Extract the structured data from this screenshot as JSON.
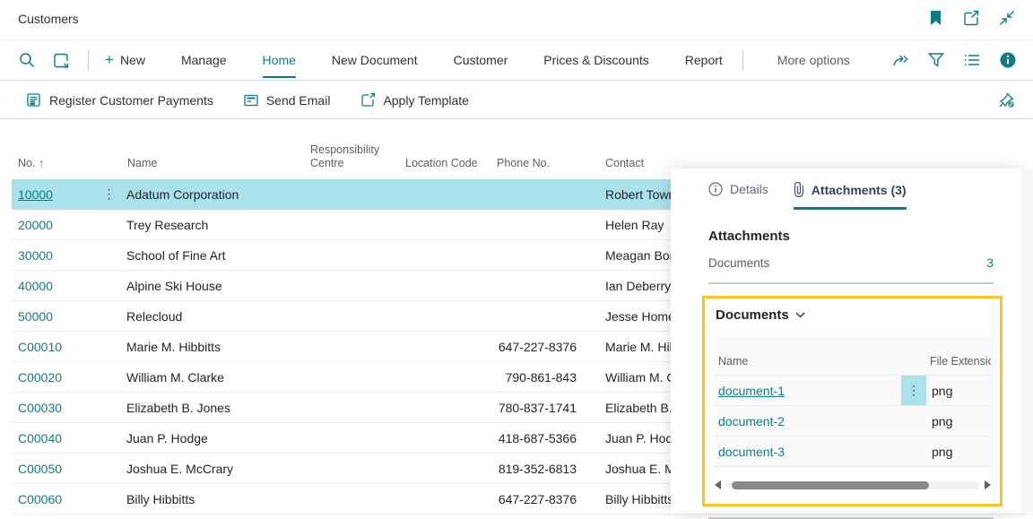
{
  "titlebar": {
    "title": "Customers",
    "icons": [
      "bookmark-icon",
      "open-in-new-icon",
      "collapse-icon"
    ]
  },
  "actionbar": {
    "left_icons": [
      "search-icon",
      "analyze-icon"
    ],
    "menu": [
      {
        "label": "New",
        "plus": true
      },
      {
        "label": "Manage"
      },
      {
        "label": "Home",
        "active": true
      },
      {
        "label": "New Document"
      },
      {
        "label": "Customer"
      },
      {
        "label": "Prices & Discounts"
      },
      {
        "label": "Report"
      }
    ],
    "more_options": "More options",
    "right_icons": [
      "share-icon",
      "filter-icon",
      "list-icon",
      "info-icon"
    ]
  },
  "quickbar": {
    "actions": [
      {
        "label": "Register Customer Payments",
        "icon": "payments-icon"
      },
      {
        "label": "Send Email",
        "icon": "email-icon"
      },
      {
        "label": "Apply Template",
        "icon": "template-icon"
      }
    ],
    "pin_icon": "unpin-icon"
  },
  "table": {
    "headers": {
      "no": "No.",
      "sort": "↑",
      "name": "Name",
      "resp": "Responsibility Centre",
      "loc": "Location Code",
      "phone": "Phone No.",
      "contact": "Contact"
    },
    "rows": [
      {
        "no": "10000",
        "name": "Adatum Corporation",
        "resp": "",
        "loc": "",
        "phone": "",
        "contact": "Robert Townes",
        "selected": true
      },
      {
        "no": "20000",
        "name": "Trey Research",
        "resp": "",
        "loc": "",
        "phone": "",
        "contact": "Helen Ray"
      },
      {
        "no": "30000",
        "name": "School of Fine Art",
        "resp": "",
        "loc": "",
        "phone": "",
        "contact": "Meagan Bond"
      },
      {
        "no": "40000",
        "name": "Alpine Ski House",
        "resp": "",
        "loc": "",
        "phone": "",
        "contact": "Ian Deberry"
      },
      {
        "no": "50000",
        "name": "Relecloud",
        "resp": "",
        "loc": "",
        "phone": "",
        "contact": "Jesse Homer"
      },
      {
        "no": "C00010",
        "name": "Marie M. Hibbitts",
        "resp": "",
        "loc": "",
        "phone": "647-227-8376",
        "contact": "Marie M. Hibbitts"
      },
      {
        "no": "C00020",
        "name": "William M. Clarke",
        "resp": "",
        "loc": "",
        "phone": "790-861-843",
        "contact": "William M. Clarke"
      },
      {
        "no": "C00030",
        "name": "Elizabeth B. Jones",
        "resp": "",
        "loc": "",
        "phone": "780-837-1741",
        "contact": "Elizabeth B. Jones"
      },
      {
        "no": "C00040",
        "name": "Juan P. Hodge",
        "resp": "",
        "loc": "",
        "phone": "418-687-5366",
        "contact": "Juan P. Hodge"
      },
      {
        "no": "C00050",
        "name": "Joshua E. McCrary",
        "resp": "",
        "loc": "",
        "phone": "819-352-6813",
        "contact": "Joshua E. McCrary"
      },
      {
        "no": "C00060",
        "name": "Billy Hibbitts",
        "resp": "",
        "loc": "",
        "phone": "647-227-8376",
        "contact": "Billy Hibbitts"
      }
    ]
  },
  "panel": {
    "tabs": [
      {
        "label": "Details",
        "icon": "info-circle-icon"
      },
      {
        "label": "Attachments (3)",
        "icon": "paperclip-icon",
        "active": true
      }
    ],
    "section_title": "Attachments",
    "documents_label": "Documents",
    "documents_count": "3",
    "box": {
      "title": "Documents",
      "grid_headers": {
        "name": "Name",
        "ext": "File Extension"
      },
      "rows": [
        {
          "name": "document-1",
          "ext": "png",
          "selected": true
        },
        {
          "name": "document-2",
          "ext": "png"
        },
        {
          "name": "document-3",
          "ext": "png"
        }
      ]
    }
  },
  "colors": {
    "accent": "#0e7c87",
    "selected_row": "#a9e2ea",
    "attention_border": "#fec223",
    "text_dark": "#252423",
    "text_gray": "#605e5c"
  }
}
